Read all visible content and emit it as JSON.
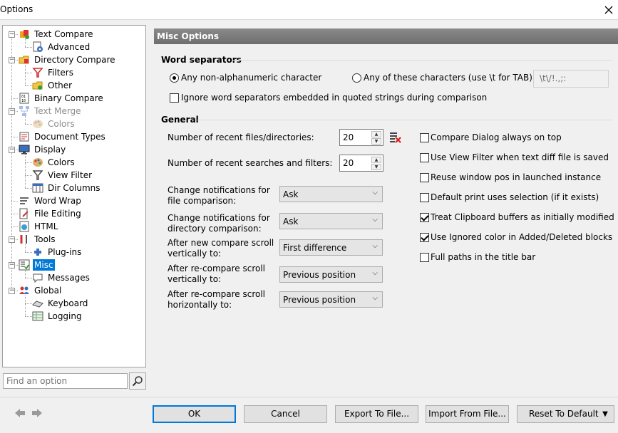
{
  "window": {
    "title": "Options"
  },
  "tree": [
    {
      "label": "Text Compare",
      "level": 0,
      "exp": "-",
      "icon": "text-compare-icon",
      "state": "normal"
    },
    {
      "label": "Advanced",
      "level": 1,
      "exp": "",
      "icon": "advanced-settings-icon",
      "state": "normal"
    },
    {
      "label": "Directory Compare",
      "level": 0,
      "exp": "-",
      "icon": "folder-compare-icon",
      "state": "normal"
    },
    {
      "label": "Filters",
      "level": 1,
      "exp": "",
      "icon": "filter-icon",
      "state": "normal"
    },
    {
      "label": "Other",
      "level": 1,
      "exp": "",
      "icon": "folder-other-icon",
      "state": "normal"
    },
    {
      "label": "Binary Compare",
      "level": 0,
      "exp": "",
      "icon": "binary-compare-icon",
      "state": "normal"
    },
    {
      "label": "Text Merge",
      "level": 0,
      "exp": "-",
      "icon": "merge-icon",
      "state": "disabled"
    },
    {
      "label": "Colors",
      "level": 1,
      "exp": "",
      "icon": "palette-icon",
      "state": "disabled"
    },
    {
      "label": "Document Types",
      "level": 0,
      "exp": "",
      "icon": "document-types-icon",
      "state": "normal"
    },
    {
      "label": "Display",
      "level": 0,
      "exp": "-",
      "icon": "display-icon",
      "state": "normal"
    },
    {
      "label": "Colors",
      "level": 1,
      "exp": "",
      "icon": "palette-icon",
      "state": "normal"
    },
    {
      "label": "View Filter",
      "level": 1,
      "exp": "",
      "icon": "view-filter-icon",
      "state": "normal"
    },
    {
      "label": "Dir Columns",
      "level": 1,
      "exp": "",
      "icon": "columns-icon",
      "state": "normal"
    },
    {
      "label": "Word Wrap",
      "level": 0,
      "exp": "",
      "icon": "word-wrap-icon",
      "state": "normal"
    },
    {
      "label": "File Editing",
      "level": 0,
      "exp": "",
      "icon": "file-editing-icon",
      "state": "normal"
    },
    {
      "label": "HTML",
      "level": 0,
      "exp": "",
      "icon": "html-icon",
      "state": "normal"
    },
    {
      "label": "Tools",
      "level": 0,
      "exp": "-",
      "icon": "tools-icon",
      "state": "normal"
    },
    {
      "label": "Plug-ins",
      "level": 1,
      "exp": "",
      "icon": "plugin-icon",
      "state": "normal"
    },
    {
      "label": "Misc",
      "level": 0,
      "exp": "-",
      "icon": "misc-icon",
      "state": "selected"
    },
    {
      "label": "Messages",
      "level": 1,
      "exp": "",
      "icon": "messages-icon",
      "state": "normal"
    },
    {
      "label": "Global",
      "level": 0,
      "exp": "-",
      "icon": "global-users-icon",
      "state": "normal"
    },
    {
      "label": "Keyboard",
      "level": 1,
      "exp": "",
      "icon": "keyboard-icon",
      "state": "normal"
    },
    {
      "label": "Logging",
      "level": 1,
      "exp": "",
      "icon": "logging-icon",
      "state": "normal"
    }
  ],
  "search": {
    "placeholder": "Find an option"
  },
  "panel": {
    "header": "Misc Options",
    "word_separators": {
      "title": "Word separators",
      "radio_any": "Any non-alphanumeric character",
      "radio_these": "Any of these characters (use \\t for TAB):",
      "chars_value": "\\t\\/!.,;:",
      "ignore_quoted": "Ignore word separators embedded in quoted strings during comparison",
      "selected_option": "Any non-alphanumeric character",
      "ignore_quoted_checked": false
    },
    "general": {
      "title": "General",
      "recent_files_label": "Number of recent files/directories:",
      "recent_files_value": "20",
      "recent_searches_label": "Number of recent searches and filters:",
      "recent_searches_value": "20",
      "change_file_label": "Change notifications for file comparison:",
      "change_file_value": "Ask",
      "change_dir_label": "Change notifications for directory comparison:",
      "change_dir_value": "Ask",
      "new_scroll_label": "After new compare scroll vertically to:",
      "new_scroll_value": "First difference",
      "re_vscroll_label": "After re-compare scroll vertically to:",
      "re_vscroll_value": "Previous position",
      "re_hscroll_label": "After re-compare scroll horizontally to:",
      "re_hscroll_value": "Previous position",
      "checkboxes": [
        {
          "label": "Compare Dialog always on top",
          "checked": false
        },
        {
          "label": "Use View Filter when text diff file is saved",
          "checked": false
        },
        {
          "label": "Reuse window pos in launched instance",
          "checked": false
        },
        {
          "label": "Default print uses selection (if it exists)",
          "checked": false
        },
        {
          "label": "Treat Clipboard buffers as initially modified",
          "checked": true
        },
        {
          "label": "Use Ignored color in Added/Deleted blocks",
          "checked": true
        },
        {
          "label": "Full paths in the title bar",
          "checked": false
        }
      ]
    }
  },
  "buttons": {
    "ok": "OK",
    "cancel": "Cancel",
    "export": "Export To File...",
    "import": "Import From File...",
    "reset": "Reset To Default"
  },
  "colors": {
    "selection": "#0078d7",
    "header_bg": "#7a7a7a"
  }
}
